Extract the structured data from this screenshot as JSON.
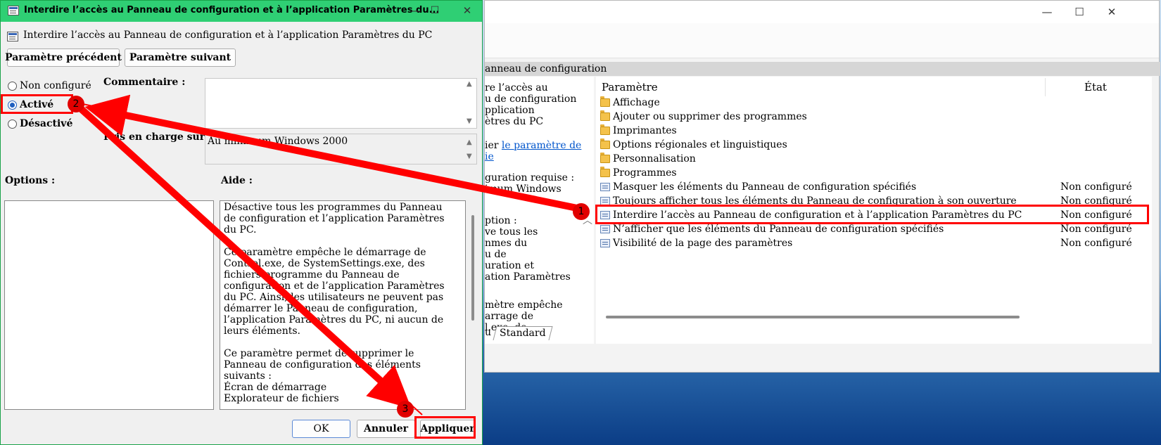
{
  "background_window": {
    "section_header": "anneau de configuration",
    "description_lines": [
      "re l’accès au",
      "u de configuration",
      "pplication",
      "ètres du PC"
    ],
    "edit_link_prefix": "ier",
    "edit_link_line1": "le paramètre de",
    "edit_link_line2": "ie",
    "requirements_lines": [
      "guration requise :",
      "imum Windows"
    ],
    "desc_lines2": [
      "ption :",
      "ve tous les",
      "nmes du",
      "u de",
      "uration et",
      "ation Paramètres"
    ],
    "desc_lines3": [
      "mètre empêche",
      "arrage de",
      "l.exe, de"
    ],
    "columns": {
      "setting": "Paramètre",
      "state": "État"
    },
    "rows": [
      {
        "type": "folder",
        "name": "Affichage",
        "state": ""
      },
      {
        "type": "folder",
        "name": "Ajouter ou supprimer des programmes",
        "state": ""
      },
      {
        "type": "folder",
        "name": "Imprimantes",
        "state": ""
      },
      {
        "type": "folder",
        "name": "Options régionales et linguistiques",
        "state": ""
      },
      {
        "type": "folder",
        "name": "Personnalisation",
        "state": ""
      },
      {
        "type": "folder",
        "name": "Programmes",
        "state": ""
      },
      {
        "type": "policy",
        "name": "Masquer les éléments du Panneau de configuration spécifiés",
        "state": "Non configuré"
      },
      {
        "type": "policy",
        "name": "Toujours afficher tous les éléments du Panneau de configuration à son ouverture",
        "state": "Non configuré"
      },
      {
        "type": "policy",
        "name": "Interdire l’accès au Panneau de configuration et à l’application Paramètres du PC",
        "state": "Non configuré"
      },
      {
        "type": "policy",
        "name": "N’afficher que les éléments du Panneau de configuration spécifiés",
        "state": "Non configuré"
      },
      {
        "type": "policy",
        "name": "Visibilité de la page des paramètres",
        "state": "Non configuré"
      }
    ],
    "tab_left": "u",
    "tab_standard": "Standard"
  },
  "dialog": {
    "title": "Interdire l’accès au Panneau de configuration et à l’application Paramètres du...",
    "heading": "Interdire l’accès au Panneau de configuration et à l’application Paramètres du PC",
    "prev_button": "Paramètre précédent",
    "next_button": "Paramètre suivant",
    "radio_options": [
      {
        "label": "Non configuré",
        "selected": false
      },
      {
        "label": "Activé",
        "selected": true
      },
      {
        "label": "Désactivé",
        "selected": false
      }
    ],
    "comment_label": "Commentaire :",
    "supported_label": "Pris en charge sur :",
    "supported_value": "Au minimum Windows 2000",
    "options_label": "Options :",
    "help_label": "Aide :",
    "help_text": "Désactive tous les programmes du Panneau de configuration et l’application Paramètres du PC.\n\nCe paramètre empêche le démarrage de Control.exe, de SystemSettings.exe, des fichiers programme du Panneau de configuration et de l’application Paramètres du PC. Ainsi, les utilisateurs ne peuvent pas démarrer le Panneau de configuration, l’application Paramètres du PC, ni aucun de leurs éléments.\n\nCe paramètre permet de supprimer le Panneau de configuration des éléments suivants :\nÉcran de démarrage\nExplorateur de fichiers\n\nCe paramètre permet de supprimer\nl’application Paramètres du PC de l’écran",
    "ok_button": "OK",
    "cancel_button": "Annuler",
    "apply_button": "Appliquer"
  },
  "annotations": {
    "badge1": "1",
    "badge2": "2",
    "badge3": "3",
    "color": "#ff0000"
  }
}
